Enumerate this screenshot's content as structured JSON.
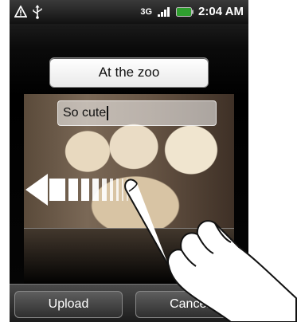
{
  "status_bar": {
    "time": "2:04 AM",
    "network": "3G",
    "icons": [
      "alert-icon",
      "usb-icon",
      "signal-icon",
      "battery-icon"
    ]
  },
  "form": {
    "title_value": "At the zoo",
    "description_value": "So cute"
  },
  "buttons": {
    "upload_label": "Upload",
    "cancel_label": "Cancel"
  }
}
